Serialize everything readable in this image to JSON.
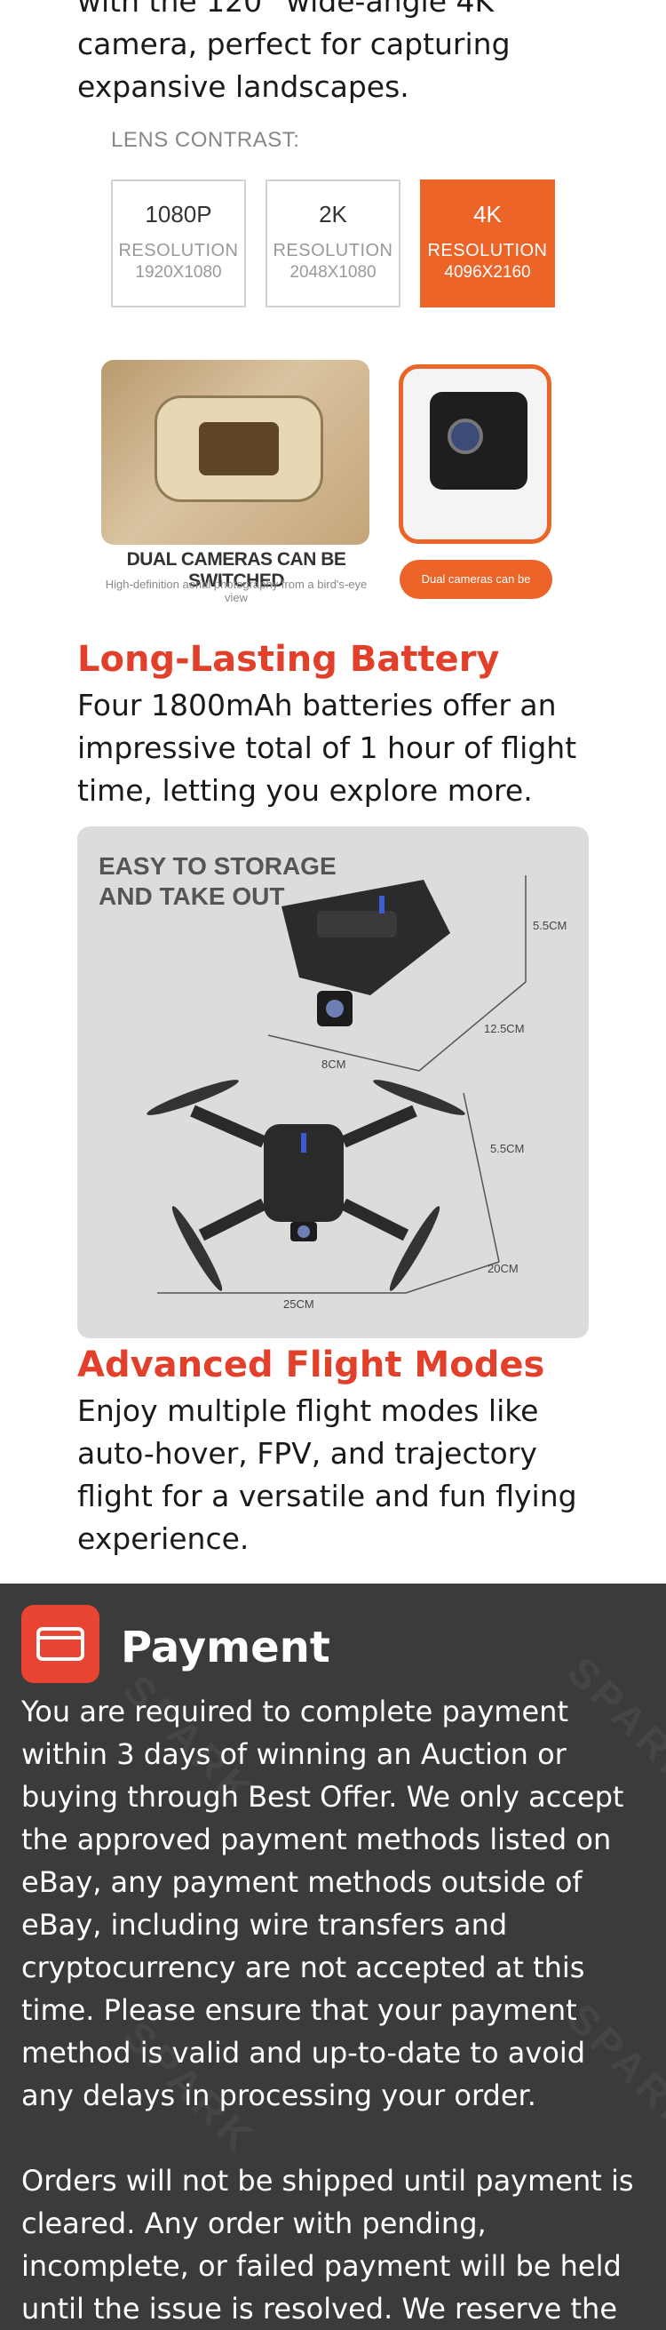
{
  "camera_section": {
    "description_tail": "with the 120° wide-angle 4K camera, perfect for capturing expansive landscapes.",
    "lens_contrast_label": "LENS CONTRAST:",
    "resolutions": [
      {
        "name": "1080P",
        "label": "RESOLUTION",
        "dims": "1920X1080",
        "selected": false
      },
      {
        "name": "2K",
        "label": "RESOLUTION",
        "dims": "2048X1080",
        "selected": false
      },
      {
        "name": "4K",
        "label": "RESOLUTION",
        "dims": "4096X2160",
        "selected": true
      }
    ],
    "dual_cameras_title": "DUAL CAMERAS CAN BE SWITCHED",
    "dual_cameras_subtitle": "High-definition aerial photography from a bird's-eye view",
    "dual_cameras_pill": "Dual cameras can be switched"
  },
  "battery_section": {
    "title": "Long-Lasting Battery",
    "description": "Four 1800mAh batteries offer an impressive total of 1 hour of flight time, letting you explore more."
  },
  "storage_image": {
    "heading_line1": "EASY TO STORAGE",
    "heading_line2": "AND TAKE OUT",
    "folded_dims": {
      "height": "5.5CM",
      "length": "12.5CM",
      "width": "8CM"
    },
    "unfolded_dims": {
      "height": "5.5CM",
      "depth": "20CM",
      "width": "25CM"
    }
  },
  "flight_section": {
    "title": "Advanced Flight Modes",
    "description": "Enjoy multiple flight modes like auto-hover, FPV, and trajectory flight for a versatile and fun flying experience."
  },
  "payment": {
    "title": "Payment",
    "icon": "credit-card-icon",
    "paragraph1": "You are required to complete payment within 3 days of winning an Auction or buying through Best Offer. We only accept the approved payment methods listed on eBay, any payment methods outside of eBay, including wire transfers and cryptocurrency are not accepted at this time. Please ensure that your payment method is valid and up-to-date to avoid any delays in processing your order.",
    "paragraph2": "Orders will not be shipped until payment is cleared. Any order with pending, incomplete, or failed payment will be held until the issue is resolved. We reserve the",
    "watermark": "SPARK"
  },
  "colors": {
    "accent_red": "#e2402a",
    "orange": "#ec6428",
    "payment_bg": "#3b3b3b",
    "payment_icon_bg": "#e94431"
  }
}
